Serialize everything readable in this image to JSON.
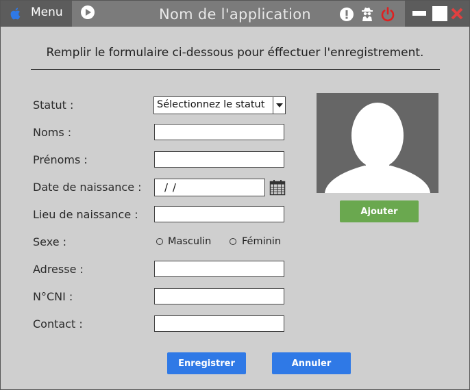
{
  "titlebar": {
    "menu_label": "Menu",
    "app_title": "Nom de l'application",
    "icons": [
      "apple-icon",
      "play-icon",
      "alert-icon",
      "spy-icon",
      "power-icon",
      "minimize-icon",
      "maximize-icon",
      "close-icon"
    ],
    "colors": {
      "bar": "#7b7b7b",
      "dark": "#5c5c5c",
      "power": "#e02020",
      "close": "#e04040",
      "apple": "#2f79e6"
    }
  },
  "form": {
    "intro": "Remplir le formulaire ci-dessous pour éffectuer l'enregistrement.",
    "statut": {
      "label": "Statut :",
      "selected": "Sélectionnez le statut"
    },
    "noms": {
      "label": "Noms :",
      "value": ""
    },
    "prenoms": {
      "label": "Prénoms :",
      "value": ""
    },
    "date_naissance": {
      "label": "Date de naissance :",
      "value": " /  /"
    },
    "lieu_naissance": {
      "label": "Lieu de naissance :",
      "value": ""
    },
    "sexe": {
      "label": "Sexe :",
      "options": [
        "Masculin",
        "Féminin"
      ]
    },
    "adresse": {
      "label": "Adresse :",
      "value": ""
    },
    "cni": {
      "label": "N°CNI :",
      "value": ""
    },
    "contact": {
      "label": "Contact :",
      "value": ""
    }
  },
  "photo": {
    "add_label": "Ajouter"
  },
  "actions": {
    "save_label": "Enregistrer",
    "cancel_label": "Annuler"
  },
  "colors": {
    "background": "#cfcfcf",
    "add_button": "#6aa84f",
    "primary_button": "#2f79e6"
  }
}
